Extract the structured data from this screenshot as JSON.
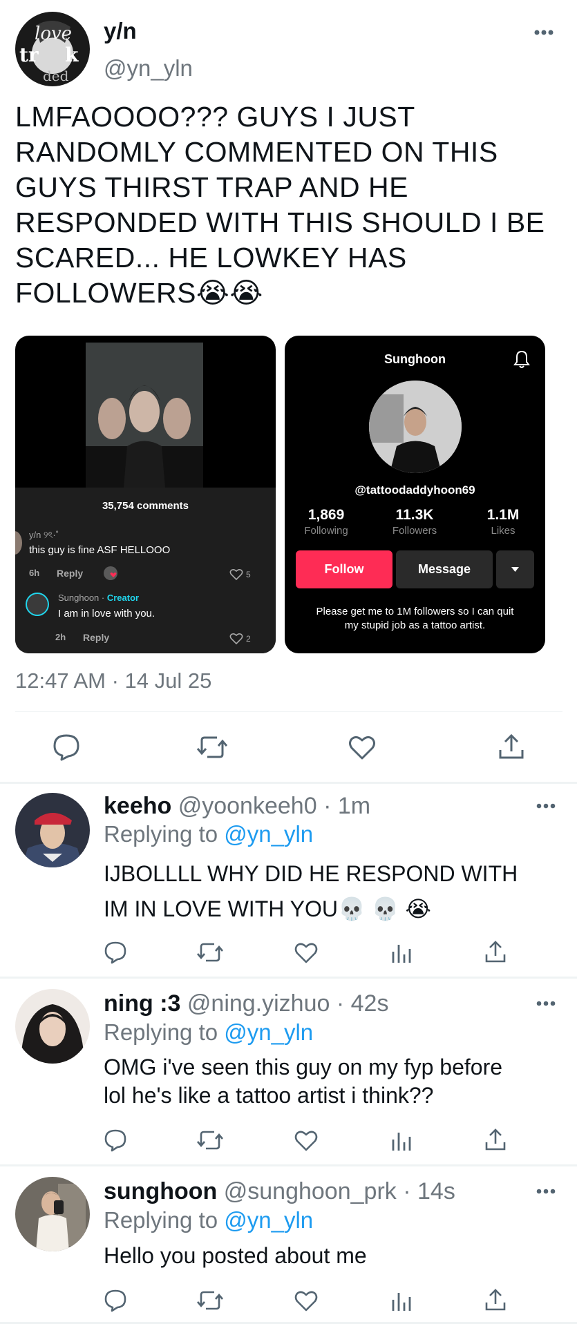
{
  "tweet": {
    "display_name": "y/n",
    "handle": "@yn_yln",
    "text_lines": [
      "LMFAOOOO??? GUYS I JUST",
      "RANDOMLY COMMENTED ON THIS",
      "GUYS THIRST TRAP AND HE",
      "RESPONDED WITH THIS SHOULD I BE",
      "SCARED... HE LOWKEY HAS",
      "FOLLOWERS😭😭"
    ],
    "timestamp": "12:47 AM · 14 Jul 25",
    "avatar_text": [
      "love",
      "trunk",
      "ded"
    ]
  },
  "media_left": {
    "comments_count": "35,754 comments",
    "comment1": {
      "user": "y/n ୨ৎ·˚",
      "text": "this guy is fine ASF HELLOOO",
      "time": "6h",
      "reply": "Reply",
      "likes": "5"
    },
    "comment2": {
      "user": "Sunghoon",
      "sep": " · ",
      "creator": "Creator",
      "text": "I am in love with you.",
      "time": "2h",
      "reply": "Reply",
      "likes": "2"
    }
  },
  "media_right": {
    "profile_name": "Sunghoon",
    "username": "@tattoodaddyhoon69",
    "stats": [
      {
        "value": "1,869",
        "label": "Following"
      },
      {
        "value": "11.3K",
        "label": "Followers"
      },
      {
        "value": "1.1M",
        "label": "Likes"
      }
    ],
    "follow_label": "Follow",
    "message_label": "Message",
    "bio_line1": "Please get me to 1M followers so I can quit",
    "bio_line2": "my stupid job as a tattoo artist."
  },
  "replies": [
    {
      "name": "keeho",
      "handle": "@yoonkeeh0",
      "time": "· 1m",
      "replying_prefix": "Replying to ",
      "replying_to": "@yn_yln",
      "lines": [
        "IJBOLLLL WHY DID HE RESPOND WITH",
        "IM IN LOVE WITH YOU💀 💀 😭"
      ]
    },
    {
      "name": "ning :3",
      "handle": "@ning.yizhuo",
      "time": "· 42s",
      "replying_prefix": "Replying to ",
      "replying_to": "@yn_yln",
      "lines": [
        "OMG i've seen this guy on my fyp before",
        "lol he's like a tattoo artist i think??"
      ]
    },
    {
      "name": "sunghoon",
      "handle": "@sunghoon_prk",
      "time": "· 14s",
      "replying_prefix": "Replying to ",
      "replying_to": "@yn_yln",
      "lines": [
        "Hello you posted about me"
      ]
    }
  ],
  "colors": {
    "accent": "#1d9bf0",
    "muted": "#6e767d",
    "follow": "#fe2c55",
    "tiktok_dark": "#121212",
    "creator": "#20d5ec"
  },
  "icons": [
    "more-icon",
    "reply-icon",
    "retweet-icon",
    "like-icon",
    "share-icon",
    "analytics-icon",
    "bell-icon",
    "heart-outline-icon",
    "dropdown-icon"
  ]
}
